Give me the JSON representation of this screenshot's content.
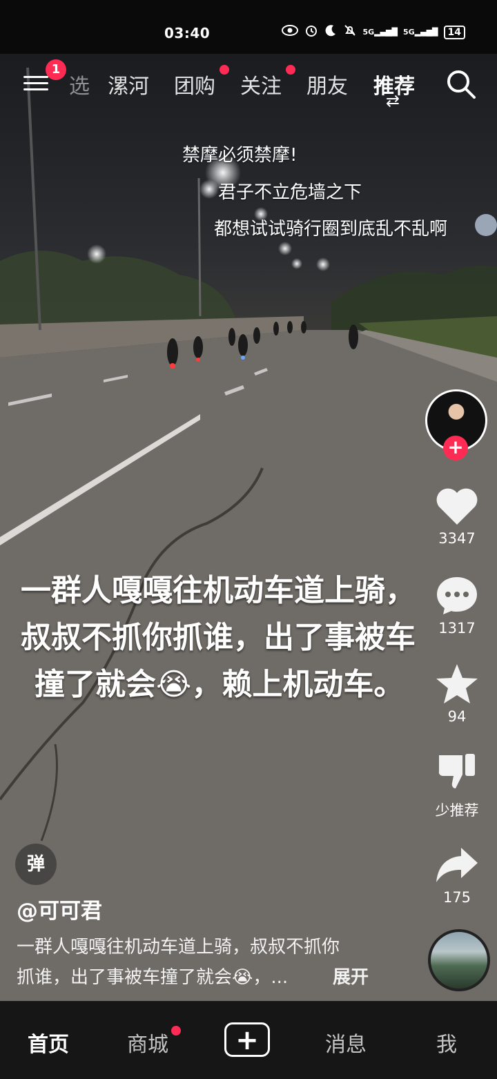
{
  "status_bar": {
    "time": "03:40",
    "battery": "14",
    "icons": [
      "eye-icon",
      "alarm-icon",
      "moon-icon",
      "mute-icon",
      "signal-5g-icon",
      "signal-5g-icon"
    ],
    "signal1": "5G",
    "signal2": "5G"
  },
  "top_nav": {
    "menu_badge": "1",
    "tabs": [
      {
        "label": "选"
      },
      {
        "label": "漯河"
      },
      {
        "label": "团购"
      },
      {
        "label": "关注"
      },
      {
        "label": "朋友"
      },
      {
        "label": "推荐"
      }
    ],
    "switch_glyph": "⇄"
  },
  "danmu": [
    "禁摩必须禁摩!",
    "君子不立危墙之下",
    "都想试试骑行圈到底乱不乱啊"
  ],
  "caption": {
    "line1": "一群人嘎嘎往机动车道上骑，",
    "line2": "叔叔不抓你抓谁，出了事被车",
    "line3": "撞了就会😭，赖上机动车。"
  },
  "actions": {
    "likes": "3347",
    "comments": "1317",
    "favorites": "94",
    "dislike_label": "少推荐",
    "shares": "175"
  },
  "video_info": {
    "danmaku_label": "弹",
    "author": "@可可君",
    "description_line1": "一群人嘎嘎往机动车道上骑，叔叔不抓你",
    "description_line2": "抓谁，出了事被车撞了就会😭，...",
    "expand_label": "展开"
  },
  "bottom_nav": {
    "home": "首页",
    "mall": "商城",
    "plus": "+",
    "messages": "消息",
    "me": "我"
  },
  "colors": {
    "accent": "#fe2c55",
    "bottom_bar": "#161616"
  }
}
